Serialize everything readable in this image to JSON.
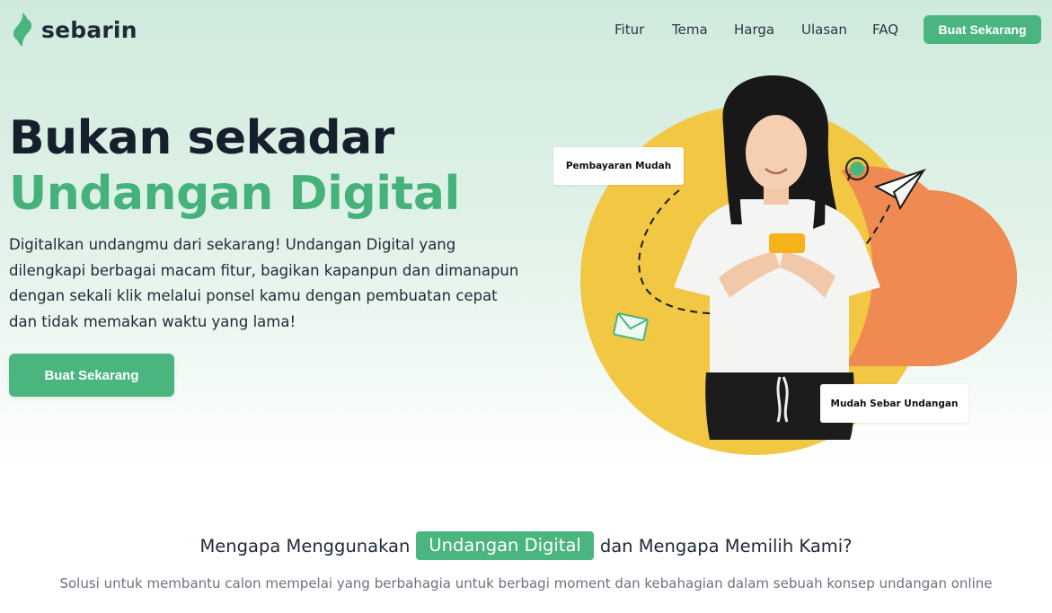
{
  "brand": {
    "name": "sebarin",
    "accent_color": "#4bb57f",
    "dark_color": "#16202d",
    "logo_icon": "sebarin-leaf-logo-icon"
  },
  "nav": {
    "links": [
      "Fitur",
      "Tema",
      "Harga",
      "Ulasan",
      "FAQ"
    ],
    "cta_label": "Buat Sekarang"
  },
  "hero": {
    "headline_line1": "Bukan sekadar",
    "headline_line2": "Undangan Digital",
    "description": "Digitalkan undangmu dari sekarang! Undangan Digital yang dilengkapi berbagai macam fitur, bagikan kapanpun dan dimanapun dengan sekali klik melalui ponsel kamu dengan pembuatan cepat dan tidak memakan waktu yang lama!",
    "cta_label": "Buat Sekarang"
  },
  "illustration": {
    "badge_payment": "Pembayaran Mudah",
    "badge_share": "Mudah Sebar Undangan",
    "icons": [
      "whatsapp-icon",
      "paper-plane-icon",
      "envelope-icon"
    ],
    "circle_colors": [
      "#f2c744",
      "#ee8a52"
    ]
  },
  "why_section": {
    "title_before": "Mengapa Menggunakan",
    "title_highlight": "Undangan Digital",
    "title_after": "dan Mengapa Memilih Kami?",
    "subtitle": "Solusi untuk membantu calon mempelai yang berbahagia untuk berbagi moment dan kebahagian dalam sebuah konsep undangan online"
  }
}
